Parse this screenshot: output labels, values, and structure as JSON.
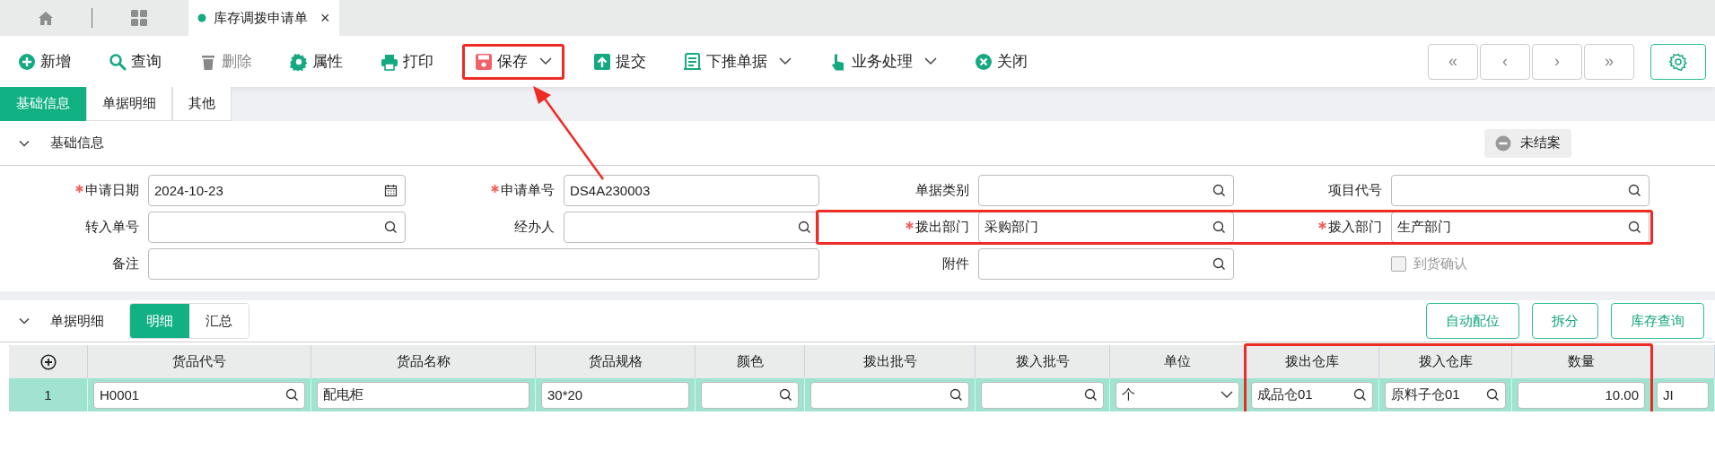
{
  "tabs": [
    {
      "kind": "home",
      "selected": false
    },
    {
      "kind": "apps",
      "selected": false
    },
    {
      "kind": "document",
      "label": "库存调拨申请单",
      "close": "×",
      "selected": true
    }
  ],
  "toolbar": {
    "items": [
      {
        "label": "新增",
        "disabled": false,
        "dropdown": false,
        "highlighted": false
      },
      {
        "label": "查询",
        "disabled": false,
        "dropdown": false,
        "highlighted": false
      },
      {
        "label": "删除",
        "disabled": true,
        "dropdown": false,
        "highlighted": false
      },
      {
        "label": "属性",
        "disabled": false,
        "dropdown": false,
        "highlighted": false
      },
      {
        "label": "打印",
        "disabled": false,
        "dropdown": false,
        "highlighted": false
      },
      {
        "label": "保存",
        "disabled": false,
        "dropdown": true,
        "highlighted": true
      },
      {
        "label": "提交",
        "disabled": false,
        "dropdown": false,
        "highlighted": false
      },
      {
        "label": "下推单据",
        "disabled": false,
        "dropdown": true,
        "highlighted": false
      },
      {
        "label": "业务处理",
        "disabled": false,
        "dropdown": true,
        "highlighted": false
      },
      {
        "label": "关闭",
        "disabled": false,
        "dropdown": false,
        "highlighted": false
      }
    ],
    "nav_buttons": [
      "«",
      "‹",
      "›",
      "»"
    ]
  },
  "section_tabs": [
    {
      "label": "基础信息",
      "selected": true
    },
    {
      "label": "单据明细",
      "selected": false
    },
    {
      "label": "其他",
      "selected": false
    }
  ],
  "basic_info": {
    "title": "基础信息",
    "expanded": true,
    "status": "未结案",
    "rows": [
      [
        {
          "label": "申请日期",
          "kind": "date",
          "value": "2024-10-23",
          "required": true,
          "highlighted": false
        },
        {
          "label": "申请单号",
          "kind": "text",
          "value": "DS4A230003",
          "required": true,
          "highlighted": false
        },
        {
          "label": "单据类别",
          "kind": "lookup",
          "required": false,
          "highlighted": false
        },
        {
          "label": "项目代号",
          "kind": "lookup",
          "required": false,
          "highlighted": false
        }
      ],
      [
        {
          "label": "转入单号",
          "kind": "lookup",
          "required": false,
          "highlighted": false
        },
        {
          "label": "经办人",
          "kind": "lookup",
          "required": false,
          "highlighted": false
        },
        {
          "label": "拨出部门",
          "kind": "lookup",
          "value": "采购部门",
          "required": true,
          "highlighted": true
        },
        {
          "label": "拨入部门",
          "kind": "lookup",
          "value": "生产部门",
          "required": true,
          "highlighted": true
        }
      ],
      [
        {
          "label": "备注",
          "kind": "wide",
          "required": false,
          "highlighted": false
        },
        "",
        {
          "label": "附件",
          "kind": "lookup",
          "required": false,
          "highlighted": false
        },
        {
          "label": "到货确认",
          "kind": "checkbox",
          "checked": false,
          "disabled": true
        }
      ]
    ]
  },
  "detail": {
    "title": "单据明细",
    "expanded": true,
    "view_tabs": [
      {
        "label": "明细",
        "selected": true
      },
      {
        "label": "汇总",
        "selected": false
      }
    ],
    "actions": [
      "自动配位",
      "拆分",
      "库存查询"
    ],
    "table": {
      "columns": [
        {
          "label": "货品代号",
          "highlighted": false
        },
        {
          "label": "货品名称",
          "highlighted": false
        },
        {
          "label": "货品规格",
          "highlighted": false
        },
        {
          "label": "颜色",
          "highlighted": false
        },
        {
          "label": "拨出批号",
          "highlighted": false
        },
        {
          "label": "拨入批号",
          "highlighted": false
        },
        {
          "label": "单位",
          "highlighted": false
        },
        {
          "label": "拨出仓库",
          "highlighted": true
        },
        {
          "label": "拨入仓库",
          "highlighted": true
        },
        {
          "label": "数量",
          "highlighted": true
        },
        {
          "highlighted": false
        }
      ],
      "rows": [
        {
          "number": "1",
          "selected": true,
          "cells": [
            {
              "kind": "lookup",
              "value": "H0001"
            },
            {
              "kind": "text",
              "value": "配电柜"
            },
            {
              "kind": "text",
              "value": "30*20"
            },
            {
              "kind": "lookup"
            },
            {
              "kind": "lookup"
            },
            {
              "kind": "lookup"
            },
            {
              "kind": "select",
              "value": "个"
            },
            {
              "kind": "lookup",
              "value": "成品仓01"
            },
            {
              "kind": "lookup",
              "value": "原料子仓01"
            },
            {
              "kind": "number",
              "value": "10.00"
            },
            {
              "kind": "text",
              "value": "JI"
            }
          ]
        }
      ]
    }
  },
  "callout_arrow": true
}
